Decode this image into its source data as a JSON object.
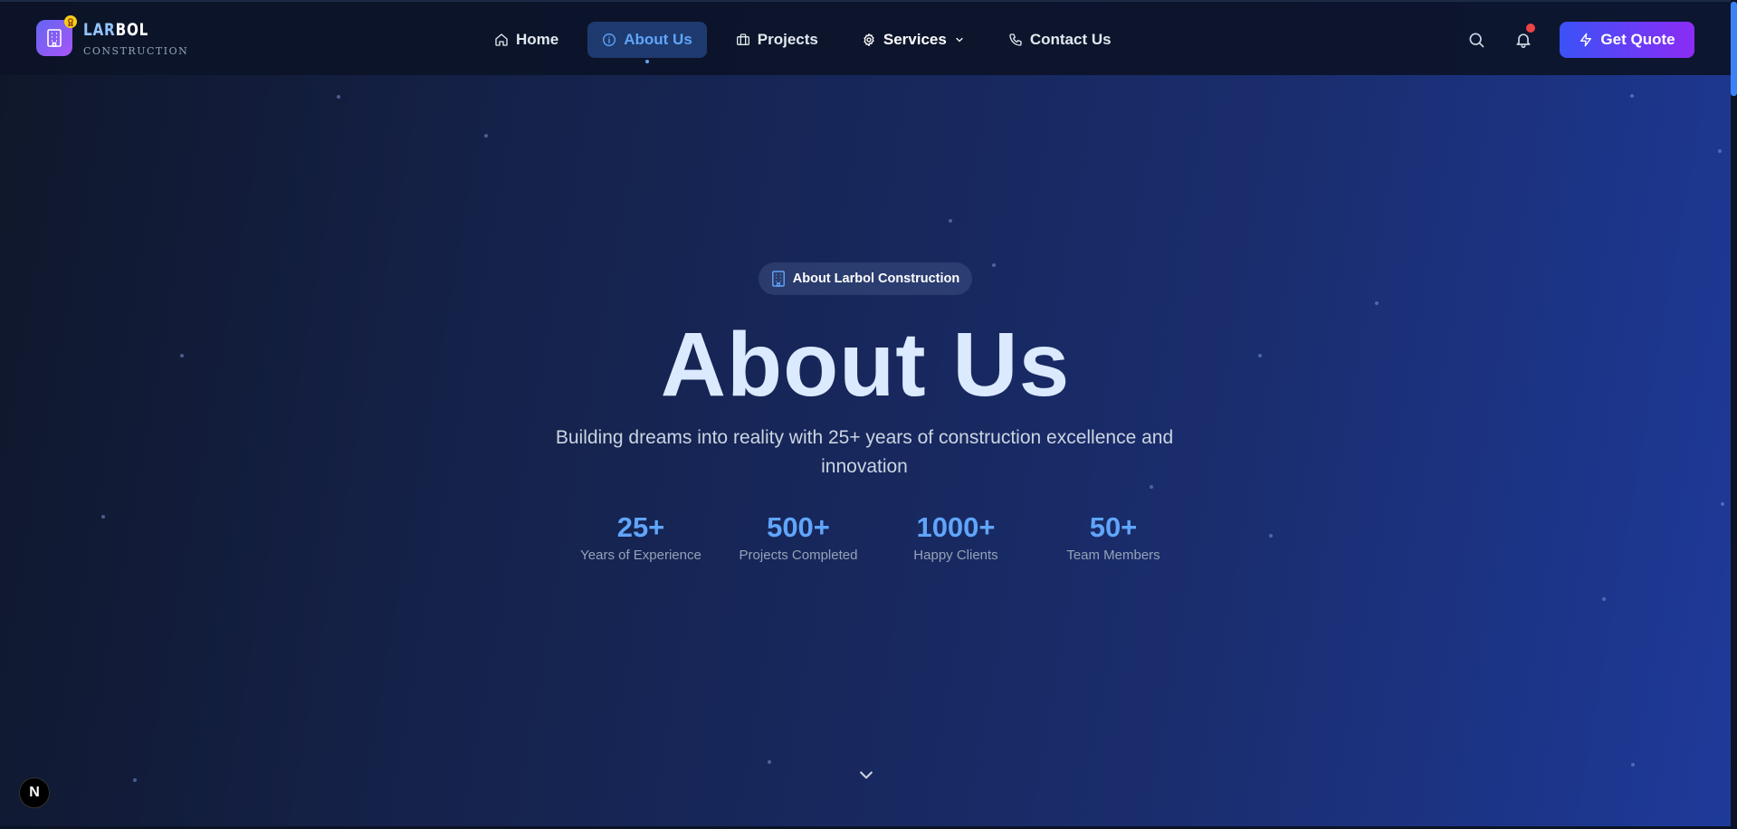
{
  "brand": {
    "name_part1": "LAR",
    "name_part2": "BOL",
    "subtitle": "CONSTRUCTION"
  },
  "nav": {
    "items": [
      {
        "label": "Home",
        "icon": "home-icon",
        "active": false
      },
      {
        "label": "About Us",
        "icon": "info-icon",
        "active": true
      },
      {
        "label": "Projects",
        "icon": "briefcase-icon",
        "active": false
      },
      {
        "label": "Services",
        "icon": "gear-icon",
        "active": false
      },
      {
        "label": "Contact Us",
        "icon": "phone-icon",
        "active": false
      }
    ]
  },
  "actions": {
    "quote_label": "Get Quote"
  },
  "hero": {
    "badge": "About Larbol Construction",
    "title": "About Us",
    "subtitle": "Building dreams into reality with 25+ years of construction excellence and innovation"
  },
  "stats": [
    {
      "value": "25+",
      "label": "Years of Experience"
    },
    {
      "value": "500+",
      "label": "Projects Completed"
    },
    {
      "value": "1000+",
      "label": "Happy Clients"
    },
    {
      "value": "50+",
      "label": "Team Members"
    }
  ],
  "fab": {
    "label": "N"
  },
  "colors": {
    "accent": "#60a5fa",
    "quote_gradient_start": "#3b52f6",
    "quote_gradient_end": "#8b2cf5",
    "notification": "#ef4444"
  }
}
